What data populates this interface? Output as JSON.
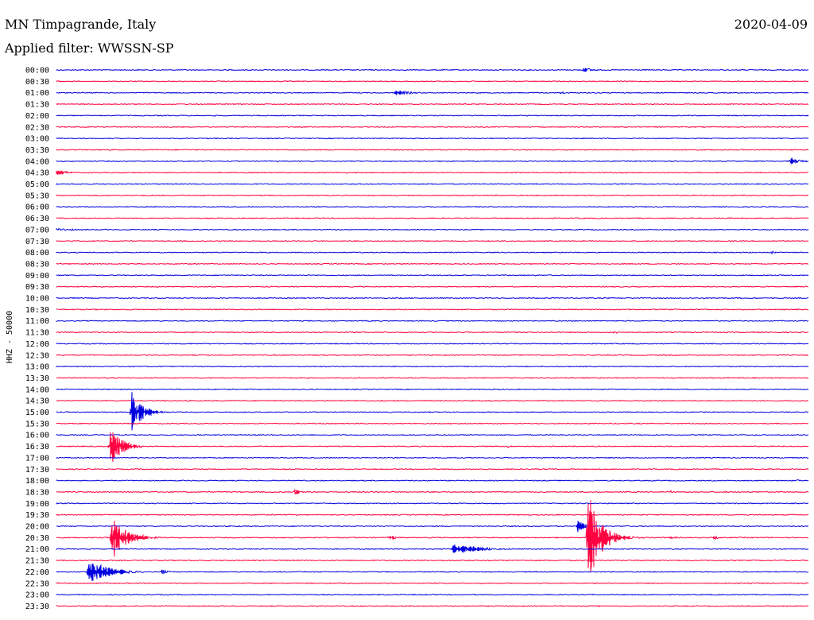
{
  "header": {
    "station": "MN Timpagrande, Italy",
    "date": "2020-04-09",
    "filter": "Applied filter: WWSSN-SP"
  },
  "colors": {
    "blue": "#0000e0",
    "red": "#ff0040"
  },
  "chart_data": {
    "type": "line",
    "title": "MN Timpagrande, Italy",
    "ylabel": "HHZ - 50000",
    "row_labels": [
      "00:00",
      "00:30",
      "01:00",
      "01:30",
      "02:00",
      "02:30",
      "03:00",
      "03:30",
      "04:00",
      "04:30",
      "05:00",
      "05:30",
      "06:00",
      "06:30",
      "07:00",
      "07:30",
      "08:00",
      "08:30",
      "09:00",
      "09:30",
      "10:00",
      "10:30",
      "11:00",
      "11:30",
      "12:00",
      "12:30",
      "13:00",
      "13:30",
      "14:00",
      "14:30",
      "15:00",
      "15:30",
      "16:00",
      "16:30",
      "17:00",
      "17:30",
      "18:00",
      "18:30",
      "19:00",
      "19:30",
      "20:00",
      "20:30",
      "21:00",
      "21:30",
      "22:00",
      "22:30",
      "23:00",
      "23:30"
    ],
    "minutes_per_row": 30,
    "color_cycle": [
      "blue",
      "red"
    ],
    "events": [
      {
        "row": "00:00",
        "minute": 21.0,
        "amp": 3,
        "dur": 1.0
      },
      {
        "row": "01:00",
        "minute": 13.5,
        "amp": 3,
        "dur": 1.6
      },
      {
        "row": "01:00",
        "minute": 20.0,
        "amp": 2,
        "dur": 1.0
      },
      {
        "row": "03:30",
        "minute": 5.0,
        "amp": 1,
        "dur": 0.8
      },
      {
        "row": "04:00",
        "minute": 29.3,
        "amp": 4,
        "dur": 0.8
      },
      {
        "row": "04:30",
        "minute": 0.0,
        "amp": 4,
        "dur": 1.0
      },
      {
        "row": "07:00",
        "minute": 0.0,
        "amp": 2,
        "dur": 1.8
      },
      {
        "row": "07:00",
        "minute": 10.0,
        "amp": 1,
        "dur": 0.4
      },
      {
        "row": "08:00",
        "minute": 28.5,
        "amp": 2,
        "dur": 0.4
      },
      {
        "row": "08:30",
        "minute": 2.8,
        "amp": 2,
        "dur": 0.5
      },
      {
        "row": "11:30",
        "minute": 12.5,
        "amp": 1,
        "dur": 0.5
      },
      {
        "row": "11:30",
        "minute": 22.2,
        "amp": 2,
        "dur": 0.8
      },
      {
        "row": "13:00",
        "minute": 15.5,
        "amp": 1,
        "dur": 1.3
      },
      {
        "row": "15:00",
        "minute": 3.0,
        "amp": 27,
        "dur": 0.9
      },
      {
        "row": "16:30",
        "minute": 2.1,
        "amp": 30,
        "dur": 0.9
      },
      {
        "row": "16:30",
        "minute": 18.0,
        "amp": 2,
        "dur": 0.4
      },
      {
        "row": "18:00",
        "minute": 29.5,
        "amp": 2,
        "dur": 0.4
      },
      {
        "row": "18:30",
        "minute": 9.5,
        "amp": 4,
        "dur": 0.5
      },
      {
        "row": "18:30",
        "minute": 24.5,
        "amp": 2,
        "dur": 0.4
      },
      {
        "row": "20:00",
        "minute": 20.8,
        "amp": 9,
        "dur": 0.5
      },
      {
        "row": "20:30",
        "minute": 2.2,
        "amp": 30,
        "dur": 1.2
      },
      {
        "row": "20:30",
        "minute": 13.3,
        "amp": 4,
        "dur": 0.5
      },
      {
        "row": "20:30",
        "minute": 21.2,
        "amp": 60,
        "dur": 1.1
      },
      {
        "row": "20:30",
        "minute": 24.5,
        "amp": 3,
        "dur": 0.4
      },
      {
        "row": "20:30",
        "minute": 26.2,
        "amp": 3,
        "dur": 0.4
      },
      {
        "row": "21:00",
        "minute": 15.8,
        "amp": 7,
        "dur": 2.2
      },
      {
        "row": "22:00",
        "minute": 1.3,
        "amp": 16,
        "dur": 1.6
      },
      {
        "row": "22:00",
        "minute": 4.2,
        "amp": 3,
        "dur": 0.6
      }
    ]
  }
}
